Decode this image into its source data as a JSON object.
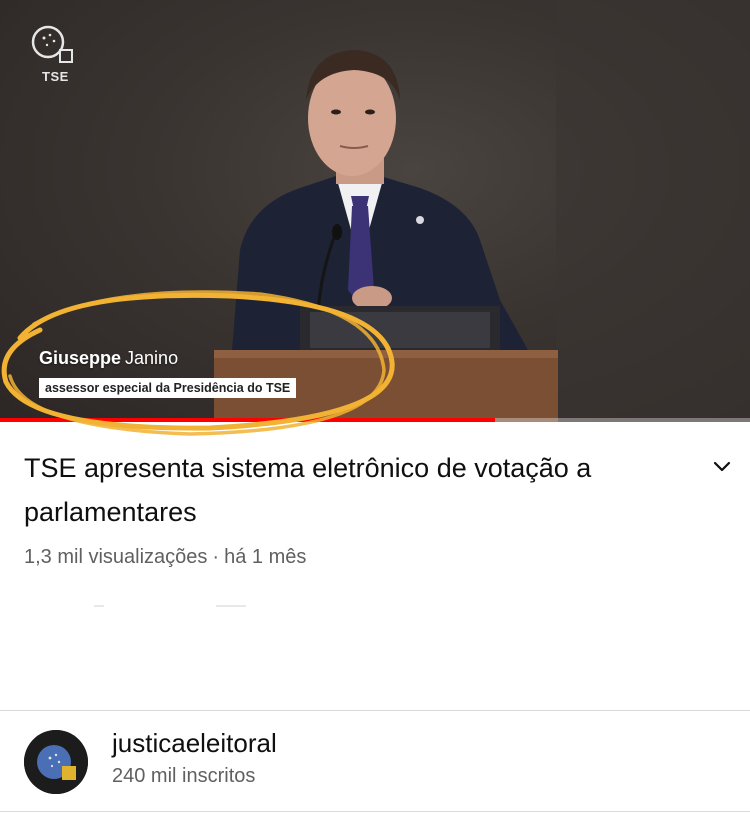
{
  "video": {
    "channel_logo_text": "TSE",
    "lower_third": {
      "first_name": "Giuseppe",
      "last_name": "Janino",
      "role": "assessor especial da Presidência do TSE"
    },
    "progress_fraction": 0.66,
    "highlight_color": "#f2b233",
    "progress_color": "#ff0000"
  },
  "info": {
    "title": "TSE apresenta sistema eletrônico de votação a parlamentares",
    "views": "1,3 mil visualizações",
    "separator": "·",
    "age": "há 1 mês",
    "expand_icon": "chevron-down-icon"
  },
  "channel": {
    "name": "justicaeleitoral",
    "subscribers": "240 mil inscritos"
  }
}
